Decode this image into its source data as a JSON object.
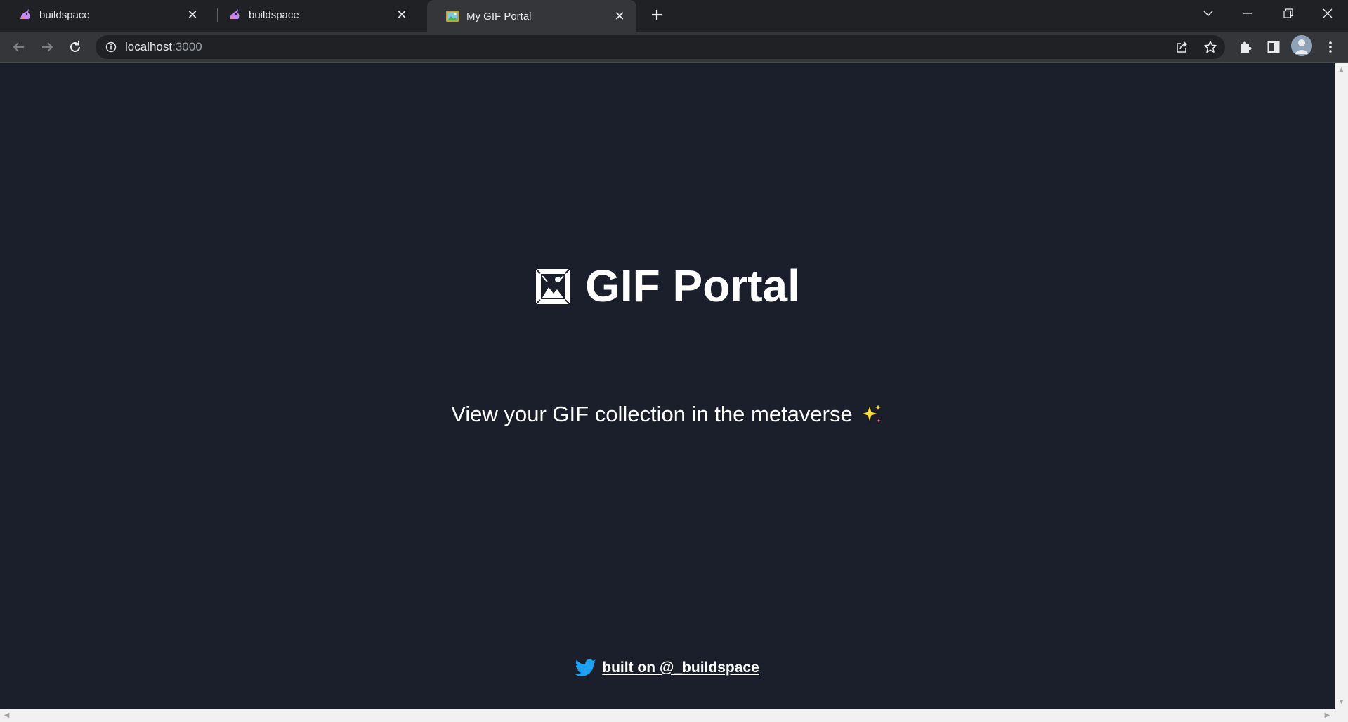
{
  "browser": {
    "tabs": [
      {
        "title": "buildspace",
        "favicon": "unicorn-icon",
        "active": false
      },
      {
        "title": "buildspace",
        "favicon": "unicorn-icon",
        "active": false
      },
      {
        "title": "My GIF Portal",
        "favicon": "framed-picture-icon",
        "active": true
      }
    ],
    "url_host": "localhost",
    "url_port": ":3000"
  },
  "page": {
    "title": "GIF Portal",
    "title_icon": "framed-picture-icon",
    "subtitle": "View your GIF collection in the metaverse",
    "subtitle_icon": "sparkles-icon",
    "footer_link": "built on @_buildspace",
    "footer_icon": "twitter-icon"
  },
  "colors": {
    "background": "#1a1f2b",
    "text": "#ffffff",
    "twitter": "#1da1f2"
  }
}
